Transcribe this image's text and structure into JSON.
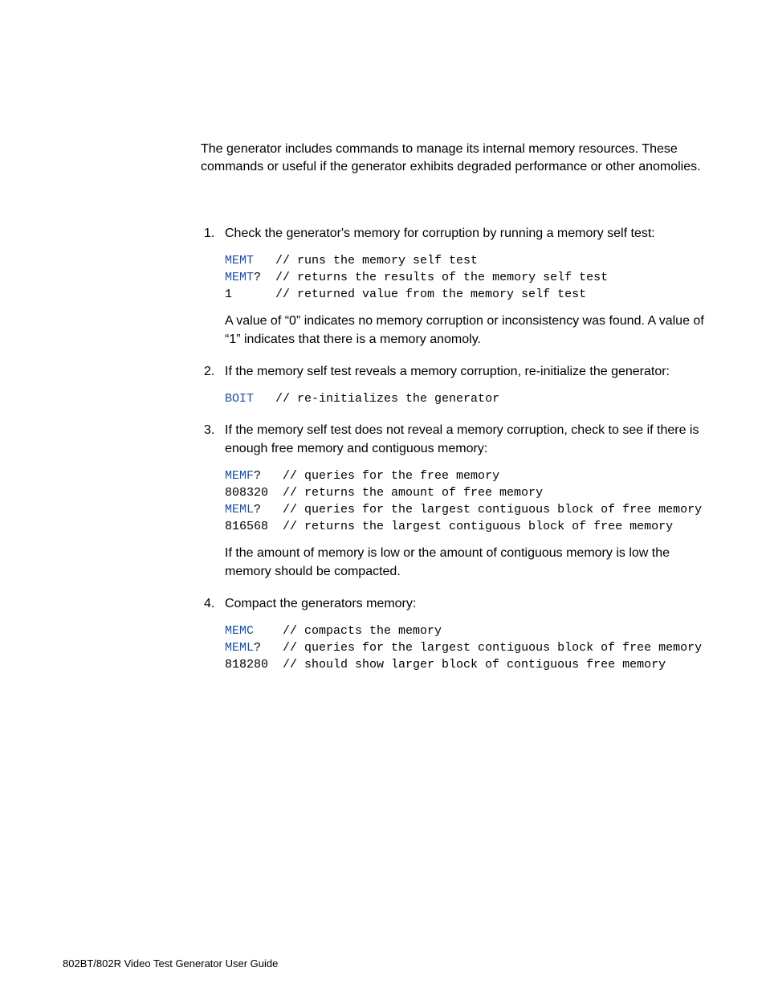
{
  "intro": "The generator includes commands to manage its internal memory resources. These commands or useful if the generator exhibits degraded performance or other anomolies.",
  "steps": [
    {
      "text": "Check the generator's memory for corruption by running a memory self test:",
      "code": {
        "lines": [
          {
            "cmd": "MEMT",
            "rest": "   // runs the memory self test"
          },
          {
            "cmd": "MEMT",
            "rest": "?  // returns the results of the memory self test"
          },
          {
            "cmd": "",
            "rest": "1      // returned value from the memory self test"
          }
        ]
      },
      "followup": "A value of “0” indicates no memory corruption or inconsistency was found. A value of “1” indicates that there is a memory anomoly."
    },
    {
      "text": "If the memory self test reveals a memory corruption, re-initialize the generator:",
      "code": {
        "lines": [
          {
            "cmd": "BOIT",
            "rest": "   // re-initializes the generator"
          }
        ]
      }
    },
    {
      "text": "If the memory self test does not reveal a memory corruption, check to see if there is enough free memory and contiguous memory:",
      "code": {
        "lines": [
          {
            "cmd": "MEMF",
            "rest": "?   // queries for the free memory"
          },
          {
            "cmd": "",
            "rest": "808320  // returns the amount of free memory"
          },
          {
            "cmd": "MEML",
            "rest": "?   // queries for the largest contiguous block of free memory"
          },
          {
            "cmd": "",
            "rest": "816568  // returns the largest contiguous block of free memory"
          }
        ]
      },
      "followup": "If the amount of memory is low or the amount of contiguous memory is low the memory should be compacted."
    },
    {
      "text": "Compact the generators memory:",
      "code": {
        "lines": [
          {
            "cmd": "MEMC",
            "rest": "    // compacts the memory"
          },
          {
            "cmd": "MEML",
            "rest": "?   // queries for the largest contiguous block of free memory"
          },
          {
            "cmd": "",
            "rest": "818280  // should show larger block of contiguous free memory"
          }
        ]
      }
    }
  ],
  "footer": "802BT/802R Video Test Generator User Guide"
}
